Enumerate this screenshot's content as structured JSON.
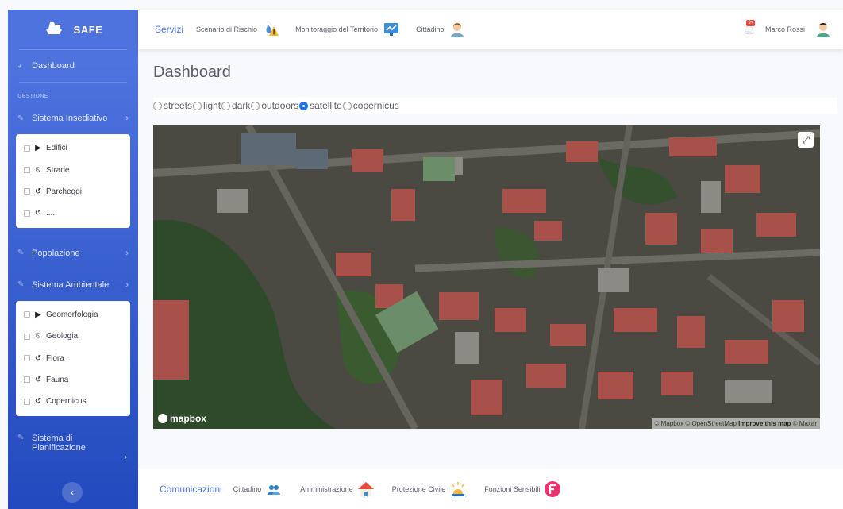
{
  "brand": {
    "name": "SAFE",
    "icon": "ship-icon"
  },
  "sidebar": {
    "dashboard": "Dashboard",
    "heading": "GESTIONE",
    "groups": [
      {
        "label": "Sistema Insediativo",
        "items": [
          "Edifici",
          "Strade",
          "Parcheggi",
          "...."
        ]
      },
      {
        "label": "Popolazione"
      },
      {
        "label": "Sistema Ambientale",
        "items": [
          "Geomorfologia",
          "Geologia",
          "Flora",
          "Fauna",
          "Copernicus"
        ]
      },
      {
        "label": "Sistema di Pianificazione"
      }
    ],
    "collapse": "‹"
  },
  "topbar": {
    "active": "Servizi",
    "links": [
      "Scenario di Rischio",
      "Monitoraggio del Territorio",
      "Cittadino"
    ],
    "badge": "9+",
    "user": "Marco Rossi"
  },
  "main": {
    "title": "Dashboard",
    "styles": [
      "streets",
      "light",
      "dark",
      "outdoors",
      "satellite",
      "copernicus"
    ],
    "selected_style": "satellite"
  },
  "map": {
    "logo": "mapbox",
    "attribution": {
      "copy1": "© Mapbox",
      "copy2": "© OpenStreetMap",
      "improve": "Improve this map",
      "copy3": "© Maxar"
    }
  },
  "footer": {
    "active": "Comunicazioni",
    "links": [
      "Cittadino",
      "Amministrazione",
      "Protezione Civile",
      "Funzioni Sensibili"
    ]
  },
  "colors": {
    "primary": "#4e73df",
    "sidebar_dark": "#224abe"
  }
}
